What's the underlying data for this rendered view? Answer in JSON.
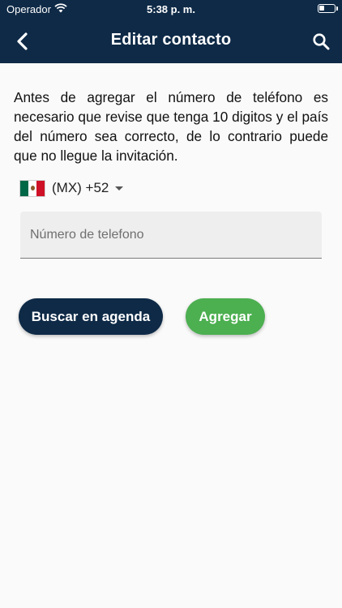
{
  "colors": {
    "primary": "#0e2a47",
    "accent_green": "#4caf50",
    "background": "#fafafa",
    "field_background": "#eeeeee"
  },
  "status_bar": {
    "carrier": "Operador",
    "time": "5:38 p. m.",
    "wifi_icon": "wifi-icon",
    "battery_icon": "battery-icon"
  },
  "app_bar": {
    "title": "Editar contacto",
    "back_icon": "chevron-left-icon",
    "search_icon": "search-icon"
  },
  "instructions": "Antes de agregar el número de teléfono es necesario que revise que tenga 10 digitos y el país del número sea correcto, de lo contrario puede que no llegue la invitación.",
  "country_picker": {
    "flag_icon": "mexico-flag-icon",
    "code": "(MX) +52",
    "arrow_icon": "caret-down-icon"
  },
  "phone_input": {
    "value": "",
    "placeholder": "Número de telefono"
  },
  "buttons": {
    "search_contacts": "Buscar en agenda",
    "add": "Agregar"
  }
}
